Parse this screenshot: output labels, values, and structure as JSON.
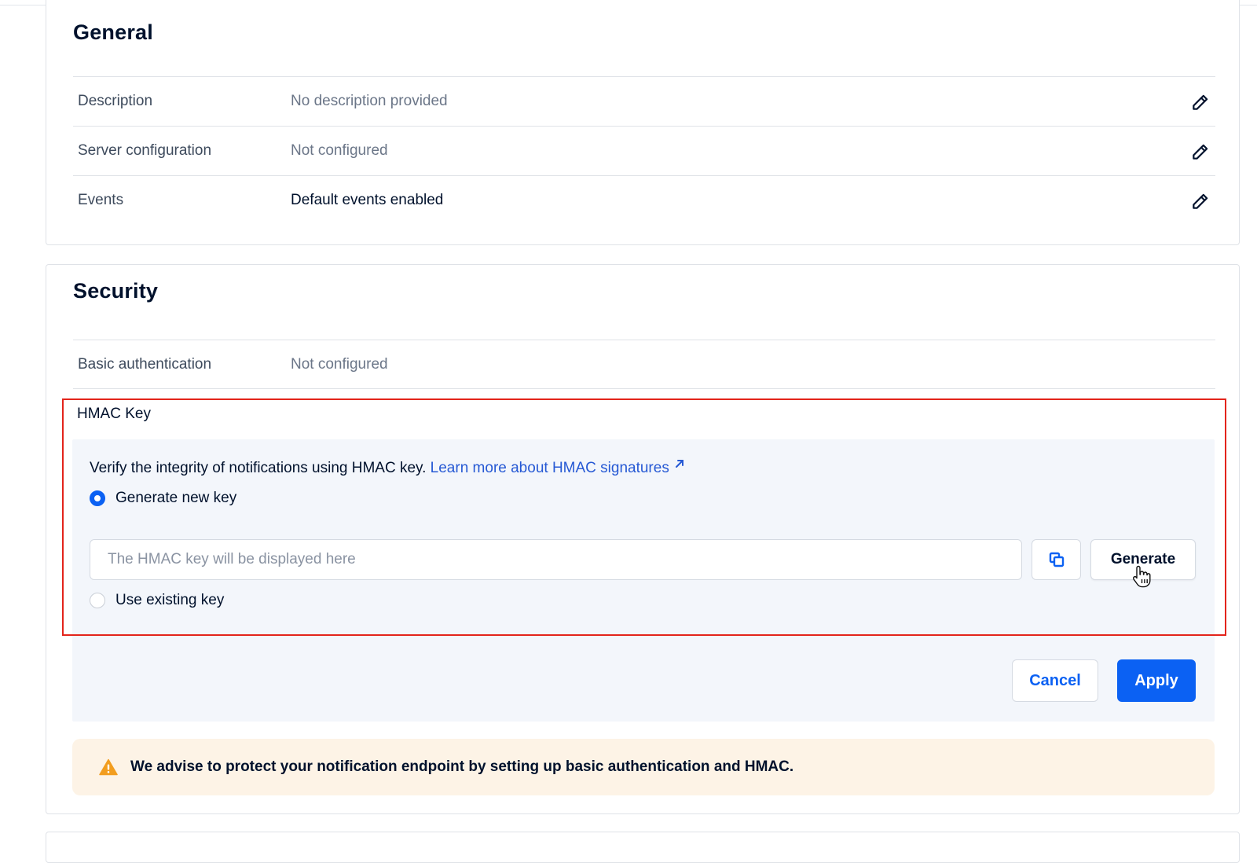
{
  "general": {
    "title": "General",
    "rows": [
      {
        "label": "Description",
        "value": "No description provided"
      },
      {
        "label": "Server configuration",
        "value": "Not configured"
      },
      {
        "label": "Events",
        "value": "Default events enabled"
      }
    ]
  },
  "security": {
    "title": "Security",
    "basic_auth": {
      "label": "Basic authentication",
      "value": "Not configured"
    },
    "hmac": {
      "title": "HMAC Key",
      "intro_text": "Verify the integrity of notifications using HMAC key. ",
      "learn_more": "Learn more about HMAC signatures",
      "option_generate": "Generate new key",
      "option_existing": "Use existing key",
      "selected_option": "generate",
      "key_placeholder": "The HMAC key will be displayed here",
      "key_value": "",
      "generate_label": "Generate",
      "cancel_label": "Cancel",
      "apply_label": "Apply"
    },
    "warning": "We advise to protect your notification endpoint by setting up basic authentication and HMAC."
  },
  "colors": {
    "accent": "#0b61f3",
    "link": "#2659d4",
    "highlight": "#e3241b",
    "warning_bg": "#fdf3e6",
    "warning_icon": "#f29d1f",
    "panel_bg": "#f3f6fb"
  },
  "icons": {
    "edit": "pencil-icon",
    "external": "external-link-icon",
    "copy": "copy-icon",
    "warning": "warning-triangle-icon",
    "cursor": "hand-pointer-icon"
  }
}
